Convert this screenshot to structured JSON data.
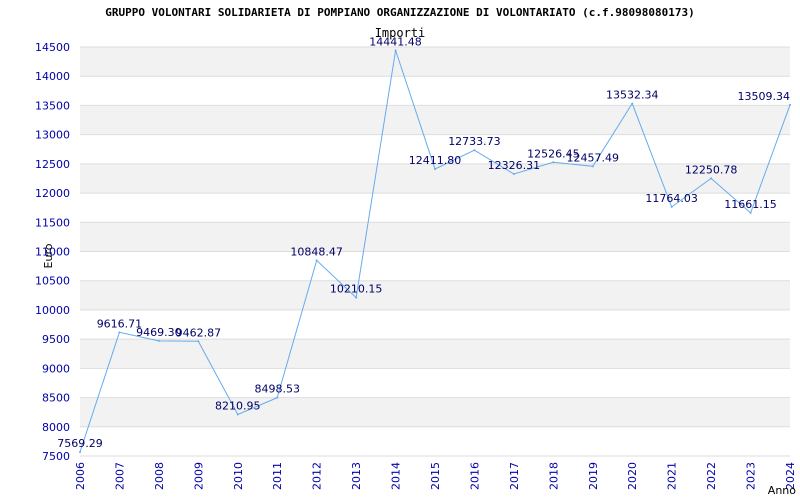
{
  "chart_data": {
    "type": "line",
    "title": "GRUPPO VOLONTARI SOLIDARIETA DI POMPIANO ORGANIZZAZIONE DI VOLONTARIATO (c.f.98098080173)",
    "subtitle": "Importi",
    "xlabel": "Anno",
    "ylabel": "Euro",
    "ylim": [
      7500,
      14500
    ],
    "ytick_step": 500,
    "grid": true,
    "categories": [
      "2006",
      "2007",
      "2008",
      "2009",
      "2010",
      "2011",
      "2012",
      "2013",
      "2014",
      "2015",
      "2016",
      "2017",
      "2018",
      "2019",
      "2020",
      "2021",
      "2022",
      "2023",
      "2024"
    ],
    "series": [
      {
        "values": [
          7569.29,
          9616.71,
          9469.3,
          9462.87,
          8210.95,
          8498.53,
          10848.47,
          10210.15,
          14441.48,
          12411.8,
          12733.73,
          12326.31,
          12526.45,
          12457.49,
          13532.34,
          11764.03,
          12250.78,
          11661.15,
          13509.34
        ],
        "labels": [
          "7569.29",
          "9616.71",
          "9469.30",
          "9462.87",
          "8210.95",
          "8498.53",
          "10848.47",
          "10210.15",
          "14441.48",
          "12411.80",
          "12733.73",
          "12326.31",
          "12526.45",
          "12457.49",
          "13532.34",
          "11764.03",
          "12250.78",
          "11661.15",
          "13509.34"
        ]
      }
    ],
    "colors": {
      "line": "#66aaee",
      "band": "#f2f2f2",
      "grid": "#dddddd",
      "axis_text": "#0000aa",
      "label_text": "#000066"
    }
  }
}
